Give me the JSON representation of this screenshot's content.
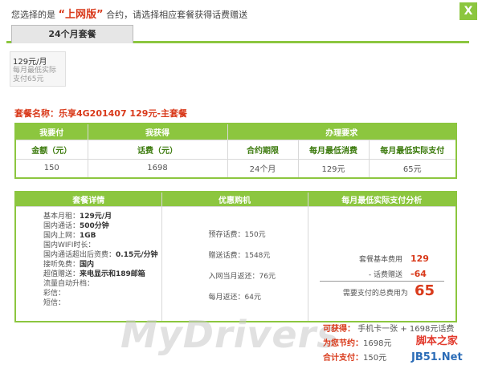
{
  "header": {
    "prefix": "您选择的是",
    "highlight": "“上网版”",
    "suffix": "合约，请选择相应套餐获得话费赠送",
    "close": "X"
  },
  "tabs": [
    {
      "label": "24个月套餐"
    }
  ],
  "plan_card": {
    "price": "129元/月",
    "sub1": "每月最低实际",
    "sub2": "支付65元"
  },
  "plan_name": "套餐名称：乐享4G201407 129元-主套餐",
  "table1": {
    "group_headers": [
      "我要付",
      "我获得",
      "办理要求"
    ],
    "columns": [
      "金额（元）",
      "话费（元）",
      "合约期限",
      "每月最低消费",
      "每月最低实际支付"
    ],
    "row": [
      "150",
      "1698",
      "24个月",
      "129元",
      "65元"
    ]
  },
  "table2": {
    "headers": [
      "套餐详情",
      "优惠购机",
      "每月最低实际支付分析"
    ],
    "details": [
      {
        "label": "基本月租：",
        "value": "129元/月"
      },
      {
        "label": "国内通话：",
        "value": "500分钟"
      },
      {
        "label": "国内上网：",
        "value": "1GB"
      },
      {
        "label": "国内WIFI时长：",
        "value": ""
      },
      {
        "label": "国内通话超出后资费：",
        "value": "0.15元/分钟"
      },
      {
        "label": "接听免费：",
        "value": "国内"
      },
      {
        "label": "超值赠送：",
        "value": "来电显示和189邮箱"
      },
      {
        "label": "流量自动升档：",
        "value": ""
      },
      {
        "label": "彩信：",
        "value": ""
      },
      {
        "label": "短信：",
        "value": ""
      }
    ],
    "purchase": [
      "预存话费：150元",
      "赠送话费：1548元",
      "入网当月返还：76元",
      "每月返还：64元"
    ],
    "analysis": {
      "base_label": "套餐基本费用",
      "base_value": "129",
      "gift_label": "- 话费赠送",
      "gift_value": "-64",
      "total_label": "需要支付的总费用为",
      "total_value": "65"
    }
  },
  "bottom": {
    "gain_label": "可获得：",
    "gain_value": "手机卡一张 + 1698元话费",
    "save_label": "为您节约：",
    "save_value": "1698元",
    "pay_label": "合计支付：",
    "pay_value": "150元"
  },
  "watermark": {
    "main": "MyDrivers",
    "site1": "脚本之家",
    "site2": "JB51.Net"
  },
  "colors": {
    "accent": "#8cc63f",
    "highlight": "#d93a1b"
  }
}
